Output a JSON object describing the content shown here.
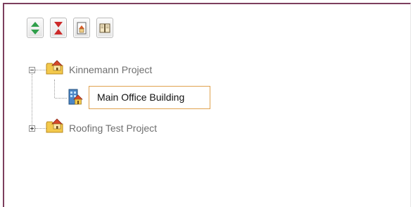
{
  "toolbar": {
    "buttons": [
      {
        "icon": "expand-all-icon"
      },
      {
        "icon": "collapse-all-icon"
      },
      {
        "icon": "document-house-icon"
      },
      {
        "icon": "book-icon"
      }
    ]
  },
  "tree": {
    "projects": [
      {
        "label": "Kinnemann Project",
        "expanded": true,
        "icon": "folder-house-icon",
        "children": [
          {
            "label": "Main Office Building",
            "icon": "building-icon",
            "selected": true
          }
        ]
      },
      {
        "label": "Roofing Test Project",
        "expanded": false,
        "icon": "folder-house-icon"
      }
    ]
  },
  "colors": {
    "frame_border": "#7d3f5e",
    "selection_border": "#e0a24f",
    "label_text": "#6f6f6f",
    "selected_text": "#111111"
  }
}
